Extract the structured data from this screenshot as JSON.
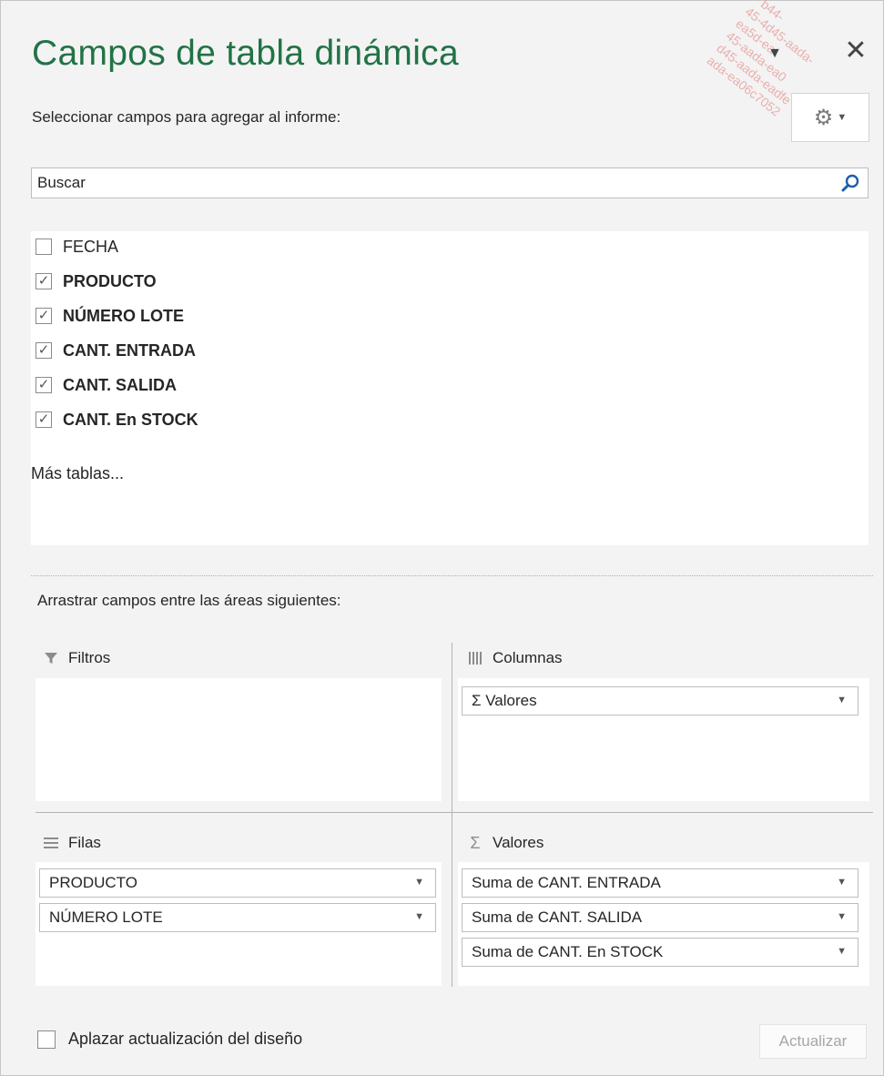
{
  "pane": {
    "title": "Campos de tabla dinámica",
    "subtitle": "Seleccionar campos para agregar al informe:",
    "menu_icon": "chevron-down-icon",
    "close_icon": "close-icon",
    "tools_icon": "gear-icon",
    "watermark": "- b44-\n45-4d45-aada-\nea5d-ea\n45-aada-ea0\nd45-aada-eadfe\nada-ea06c7052"
  },
  "search": {
    "placeholder": "Buscar",
    "icon": "search-icon"
  },
  "fields": [
    {
      "label": "FECHA",
      "checked": false
    },
    {
      "label": "PRODUCTO",
      "checked": true
    },
    {
      "label": "NÚMERO LOTE",
      "checked": true
    },
    {
      "label": "CANT. ENTRADA",
      "checked": true
    },
    {
      "label": "CANT. SALIDA",
      "checked": true
    },
    {
      "label": "CANT. En STOCK",
      "checked": true
    }
  ],
  "more_tables": "Más tablas...",
  "areas": {
    "drag_label": "Arrastrar campos entre las áreas siguientes:",
    "filters": {
      "label": "Filtros",
      "icon": "filter-icon",
      "items": []
    },
    "columns": {
      "label": "Columnas",
      "icon": "columns-icon",
      "items": [
        "Σ  Valores"
      ]
    },
    "rows": {
      "label": "Filas",
      "icon": "rows-icon",
      "items": [
        "PRODUCTO",
        "NÚMERO LOTE"
      ]
    },
    "values": {
      "label": "Valores",
      "icon": "sigma-icon",
      "items": [
        "Suma de CANT. ENTRADA",
        "Suma de CANT. SALIDA",
        "Suma de CANT. En STOCK"
      ]
    }
  },
  "footer": {
    "defer_label": "Aplazar actualización del diseño",
    "defer_checked": false,
    "update_button": "Actualizar"
  },
  "colors": {
    "title": "#217346",
    "pane_background": "#f3f3f3",
    "watermark": "#e8a3a3",
    "disabled_text": "#a6a6a6"
  }
}
